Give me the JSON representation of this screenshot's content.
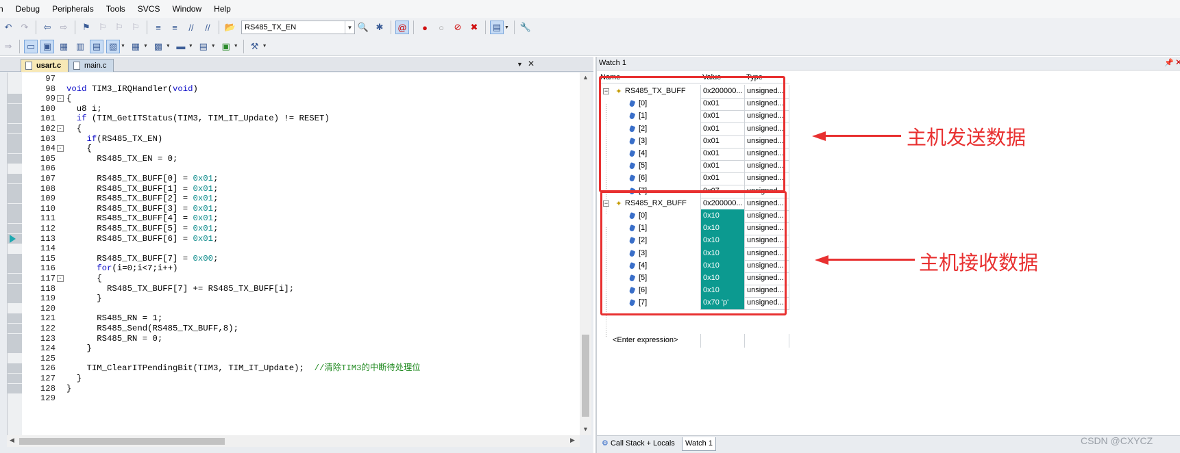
{
  "menu": [
    "n",
    "Debug",
    "Peripherals",
    "Tools",
    "SVCS",
    "Window",
    "Help"
  ],
  "toolbar": {
    "combo_value": "RS485_TX_EN"
  },
  "editor": {
    "tabs": [
      {
        "label": "usart.c",
        "active": true
      },
      {
        "label": "main.c",
        "active": false
      }
    ],
    "lines": [
      {
        "n": "97",
        "code": "",
        "mark": false,
        "fold": ""
      },
      {
        "n": "98",
        "code": "void TIM3_IRQHandler(void)",
        "mark": false,
        "fold": ""
      },
      {
        "n": "99",
        "code": "{",
        "mark": true,
        "fold": "-"
      },
      {
        "n": "100",
        "code": "  u8 i;",
        "mark": true,
        "fold": ""
      },
      {
        "n": "101",
        "code": "  if (TIM_GetITStatus(TIM3, TIM_IT_Update) != RESET)",
        "mark": true,
        "fold": ""
      },
      {
        "n": "102",
        "code": "  {",
        "mark": true,
        "fold": "-"
      },
      {
        "n": "103",
        "code": "    if(RS485_TX_EN)",
        "mark": true,
        "fold": ""
      },
      {
        "n": "104",
        "code": "    {",
        "mark": true,
        "fold": "-"
      },
      {
        "n": "105",
        "code": "      RS485_TX_EN = 0;",
        "mark": true,
        "fold": ""
      },
      {
        "n": "106",
        "code": "",
        "mark": false,
        "fold": ""
      },
      {
        "n": "107",
        "code": "      RS485_TX_BUFF[0] = 0x01;",
        "mark": true,
        "fold": ""
      },
      {
        "n": "108",
        "code": "      RS485_TX_BUFF[1] = 0x01;",
        "mark": true,
        "fold": ""
      },
      {
        "n": "109",
        "code": "      RS485_TX_BUFF[2] = 0x01;",
        "mark": true,
        "fold": ""
      },
      {
        "n": "110",
        "code": "      RS485_TX_BUFF[3] = 0x01;",
        "mark": true,
        "fold": ""
      },
      {
        "n": "111",
        "code": "      RS485_TX_BUFF[4] = 0x01;",
        "mark": true,
        "fold": ""
      },
      {
        "n": "112",
        "code": "      RS485_TX_BUFF[5] = 0x01;",
        "mark": true,
        "fold": ""
      },
      {
        "n": "113",
        "code": "      RS485_TX_BUFF[6] = 0x01;",
        "mark": true,
        "fold": ""
      },
      {
        "n": "114",
        "code": "",
        "mark": false,
        "fold": ""
      },
      {
        "n": "115",
        "code": "      RS485_TX_BUFF[7] = 0x00;",
        "mark": true,
        "fold": ""
      },
      {
        "n": "116",
        "code": "      for(i=0;i<7;i++)",
        "mark": true,
        "fold": ""
      },
      {
        "n": "117",
        "code": "      {",
        "mark": true,
        "fold": "-"
      },
      {
        "n": "118",
        "code": "        RS485_TX_BUFF[7] += RS485_TX_BUFF[i];",
        "mark": true,
        "fold": ""
      },
      {
        "n": "119",
        "code": "      }",
        "mark": true,
        "fold": ""
      },
      {
        "n": "120",
        "code": "",
        "mark": false,
        "fold": ""
      },
      {
        "n": "121",
        "code": "      RS485_RN = 1;",
        "mark": true,
        "fold": ""
      },
      {
        "n": "122",
        "code": "      RS485_Send(RS485_TX_BUFF,8);",
        "mark": true,
        "fold": ""
      },
      {
        "n": "123",
        "code": "      RS485_RN = 0;",
        "mark": true,
        "fold": ""
      },
      {
        "n": "124",
        "code": "    }",
        "mark": true,
        "fold": ""
      },
      {
        "n": "125",
        "code": "",
        "mark": false,
        "fold": ""
      },
      {
        "n": "126",
        "code": "    TIM_ClearITPendingBit(TIM3, TIM_IT_Update);  //清除TIM3的中断待处理位",
        "mark": true,
        "fold": ""
      },
      {
        "n": "127",
        "code": "  }",
        "mark": true,
        "fold": ""
      },
      {
        "n": "128",
        "code": "}",
        "mark": true,
        "fold": ""
      },
      {
        "n": "129",
        "code": "",
        "mark": false,
        "fold": ""
      }
    ],
    "exec_line": "113"
  },
  "watch": {
    "title": "Watch 1",
    "columns": {
      "name": "Name",
      "value": "Value",
      "type": "Type"
    },
    "rows": [
      {
        "name": "RS485_TX_BUFF",
        "value": "0x200000...",
        "type": "unsigned...",
        "level": 0,
        "changed": false
      },
      {
        "name": "[0]",
        "value": "0x01",
        "type": "unsigned...",
        "level": 1,
        "changed": false
      },
      {
        "name": "[1]",
        "value": "0x01",
        "type": "unsigned...",
        "level": 1,
        "changed": false
      },
      {
        "name": "[2]",
        "value": "0x01",
        "type": "unsigned...",
        "level": 1,
        "changed": false
      },
      {
        "name": "[3]",
        "value": "0x01",
        "type": "unsigned...",
        "level": 1,
        "changed": false
      },
      {
        "name": "[4]",
        "value": "0x01",
        "type": "unsigned...",
        "level": 1,
        "changed": false
      },
      {
        "name": "[5]",
        "value": "0x01",
        "type": "unsigned...",
        "level": 1,
        "changed": false
      },
      {
        "name": "[6]",
        "value": "0x01",
        "type": "unsigned...",
        "level": 1,
        "changed": false
      },
      {
        "name": "[7]",
        "value": "0x07",
        "type": "unsigned...",
        "level": 1,
        "changed": false
      },
      {
        "name": "RS485_RX_BUFF",
        "value": "0x200000...",
        "type": "unsigned...",
        "level": 0,
        "changed": false
      },
      {
        "name": "[0]",
        "value": "0x10",
        "type": "unsigned...",
        "level": 1,
        "changed": true
      },
      {
        "name": "[1]",
        "value": "0x10",
        "type": "unsigned...",
        "level": 1,
        "changed": true
      },
      {
        "name": "[2]",
        "value": "0x10",
        "type": "unsigned...",
        "level": 1,
        "changed": true
      },
      {
        "name": "[3]",
        "value": "0x10",
        "type": "unsigned...",
        "level": 1,
        "changed": true
      },
      {
        "name": "[4]",
        "value": "0x10",
        "type": "unsigned...",
        "level": 1,
        "changed": true
      },
      {
        "name": "[5]",
        "value": "0x10",
        "type": "unsigned...",
        "level": 1,
        "changed": true
      },
      {
        "name": "[6]",
        "value": "0x10",
        "type": "unsigned...",
        "level": 1,
        "changed": true
      },
      {
        "name": "[7]",
        "value": "0x70 'p'",
        "type": "unsigned...",
        "level": 1,
        "changed": true
      }
    ],
    "enter_expression": "<Enter expression>",
    "bottom_tabs": [
      "Call Stack + Locals",
      "Watch 1"
    ],
    "annotation_tx": "主机发送数据",
    "annotation_rx": "主机接收数据"
  },
  "watermark": "CSDN @CXYCZ",
  "colors": {
    "changed_value_bg": "#0c9a90",
    "annotation_red": "#e83030",
    "keyword_blue": "#1010c8"
  }
}
